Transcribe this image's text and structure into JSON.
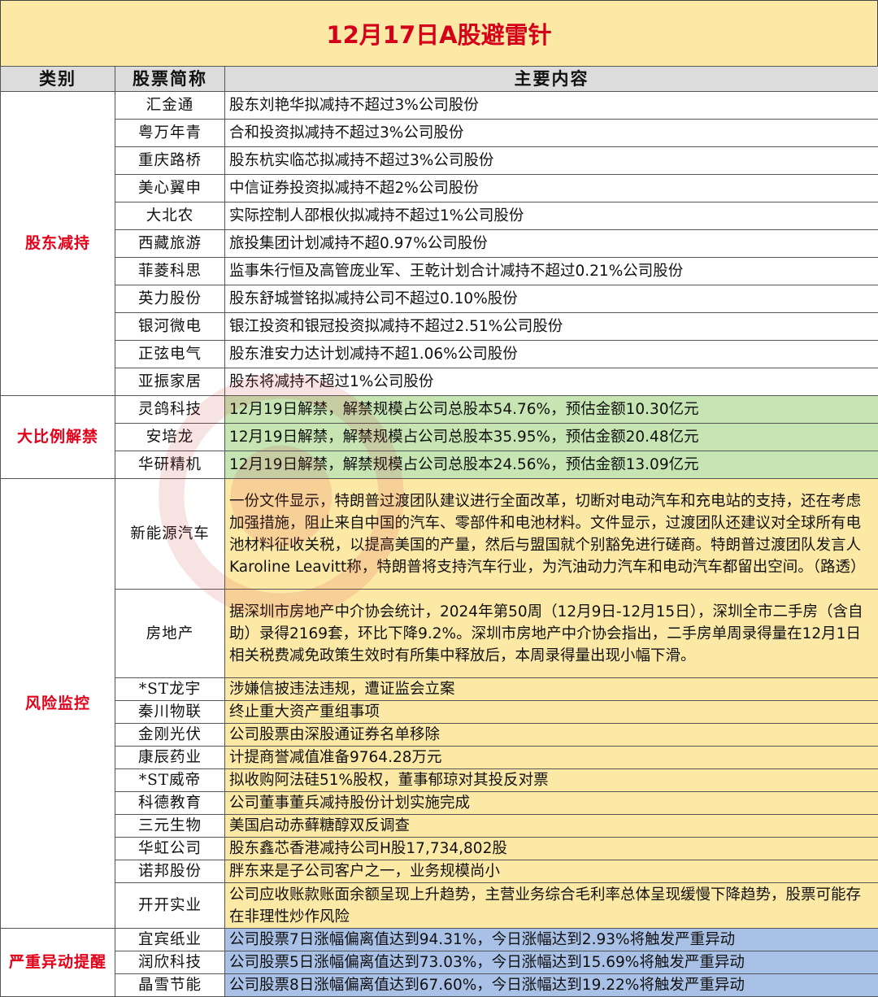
{
  "title": "12月17日A股避雷针",
  "headers": {
    "category": "类别",
    "stock": "股票简称",
    "content": "主要内容"
  },
  "groups": [
    {
      "category": "股东减持",
      "rows": [
        {
          "stock": "汇金通",
          "content": "股东刘艳华拟减持不超过3%公司股份"
        },
        {
          "stock": "粤万年青",
          "content": "合和投资拟减持不超过3%公司股份"
        },
        {
          "stock": "重庆路桥",
          "content": "股东杭实临芯拟减持不超过3%公司股份"
        },
        {
          "stock": "美心翼申",
          "content": "中信证券投资拟减持不超2%公司股份"
        },
        {
          "stock": "大北农",
          "content": "实际控制人邵根伙拟减持不超过1%公司股份"
        },
        {
          "stock": "西藏旅游",
          "content": "旅投集团计划减持不超0.97%公司股份"
        },
        {
          "stock": "菲菱科思",
          "content": "监事朱行恒及高管庞业军、王乾计划合计减持不超过0.21%公司股份"
        },
        {
          "stock": "英力股份",
          "content": "股东舒城誉铭拟减持公司不超过0.10%股份"
        },
        {
          "stock": "银河微电",
          "content": "银江投资和银冠投资拟减持不超过2.51%公司股份"
        },
        {
          "stock": "正弦电气",
          "content": "股东淮安力达计划减持不超1.06%公司股份"
        },
        {
          "stock": "亚振家居",
          "content": "股东将减持不超过1%公司股份"
        }
      ]
    },
    {
      "category": "大比例解禁",
      "rows": [
        {
          "stock": "灵鸽科技",
          "content": "12月19日解禁，解禁规模占公司总股本54.76%，预估金额10.30亿元"
        },
        {
          "stock": "安培龙",
          "content": "12月19日解禁，解禁规模占公司总股本35.95%，预估金额20.48亿元"
        },
        {
          "stock": "华研精机",
          "content": "12月19日解禁，解禁规模占公司总股本24.56%，预估金额13.09亿元"
        }
      ]
    },
    {
      "category": "风险监控",
      "rows": [
        {
          "stock": "新能源汽车",
          "content": "一份文件显示，特朗普过渡团队建议进行全面改革，切断对电动汽车和充电站的支持，还在考虑加强措施，阻止来自中国的汽车、零部件和电池材料。文件显示，过渡团队还建议对全球所有电池材料征收关税，以提高美国的产量，然后与盟国就个别豁免进行磋商。特朗普过渡团队发言人Karoline Leavitt称，特朗普将支持汽车行业，为汽油动力汽车和电动汽车都留出空间。（路透）"
        },
        {
          "stock": "房地产",
          "content": "据深圳市房地产中介协会统计，2024年第50周（12月9日-12月15日），深圳全市二手房（含自助）录得2169套，环比下降9.2%。深圳市房地产中介协会指出，二手房单周录得量在12月1日相关税费减免政策生效时有所集中释放后，本周录得量出现小幅下滑。"
        },
        {
          "stock": "*ST龙宇",
          "content": "涉嫌信披违法违规，遭证监会立案"
        },
        {
          "stock": "秦川物联",
          "content": "终止重大资产重组事项"
        },
        {
          "stock": "金刚光伏",
          "content": "公司股票由深股通证券名单移除"
        },
        {
          "stock": "康辰药业",
          "content": "计提商誉减值准备9764.28万元"
        },
        {
          "stock": "*ST威帝",
          "content": "拟收购阿法硅51%股权，董事郁琼对其投反对票"
        },
        {
          "stock": "科德教育",
          "content": "公司董事董兵减持股份计划实施完成"
        },
        {
          "stock": "三元生物",
          "content": "美国启动赤藓糖醇双反调查"
        },
        {
          "stock": "华虹公司",
          "content": "股东鑫芯香港减持公司H股17,734,802股"
        },
        {
          "stock": "诺邦股份",
          "content": "胖东来是子公司客户之一，业务规模尚小"
        },
        {
          "stock": "开开实业",
          "content": "公司应收账款账面余额呈现上升趋势，主营业务综合毛利率总体呈现缓慢下降趋势，股票可能存在非理性炒作风险"
        }
      ]
    },
    {
      "category": "严重异动提醒",
      "rows": [
        {
          "stock": "宜宾纸业",
          "content": "公司股票7日涨幅偏离值达到94.31%，今日涨幅达到2.93%将触发严重异动"
        },
        {
          "stock": "润欣科技",
          "content": "公司股票5日涨幅偏离值达到73.03%，今日涨幅达到15.69%将触发严重异动"
        },
        {
          "stock": "晶雪节能",
          "content": "公司股票8日涨幅偏离值达到67.60%，今日涨幅达到19.22%将触发严重异动"
        }
      ]
    }
  ],
  "colors": {
    "title_bg": "#fde9a6",
    "title_text": "#d4001a",
    "category_text": "#e2001a",
    "unlock_bg": "#c6e5b3",
    "risk_bg": "#fde9a6",
    "abnormal_bg": "#a9c1e6",
    "header_bg": "#dcdcdc"
  }
}
